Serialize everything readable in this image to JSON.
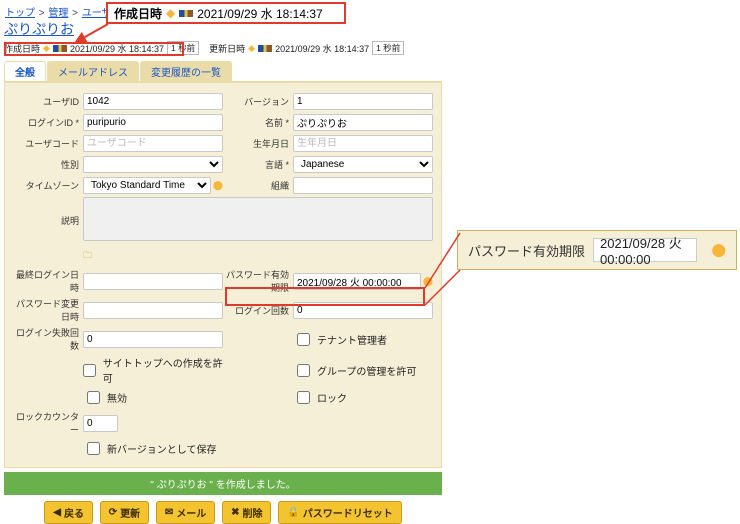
{
  "breadcrumb": {
    "top": "トップ",
    "mgmt": "管理",
    "user": "ユーザ"
  },
  "record_title": "ぷりぷりお",
  "timestamps": {
    "created_label": "作成日時",
    "created_value": "2021/09/29 水 18:14:37",
    "updated_label": "更新日時",
    "updated_value": "2021/09/29 水 18:14:37",
    "ago": "1 秒前"
  },
  "callout": {
    "label": "作成日時",
    "value": "2021/09/29 水 18:14:37"
  },
  "tabs": {
    "general": "全般",
    "mail": "メールアドレス",
    "history": "変更履歴の一覧"
  },
  "fields": {
    "user_id_l": "ユーザID",
    "user_id_v": "1042",
    "version_l": "バージョン",
    "version_v": "1",
    "login_l": "ログインID *",
    "login_v": "puripurio",
    "name_l": "名前 *",
    "name_v": "ぷりぷりお",
    "code_l": "ユーザコード",
    "code_ph": "ユーザコード",
    "birth_l": "生年月日",
    "birth_ph": "生年月日",
    "gender_l": "性別",
    "gender_v": "　",
    "lang_l": "言語 *",
    "lang_v": "Japanese",
    "tz_l": "タイムゾーン",
    "tz_v": "Tokyo Standard Time",
    "comp_l": "組織",
    "desc_l": "説明",
    "last_login_l": "最終ログイン日時",
    "pwexp_l": "パスワード有効期限",
    "pwexp_v": "2021/09/28 火 00:00:00",
    "pwchg_l": "パスワード変更日時",
    "logincnt_l": "ログイン回数",
    "logincnt_v": "0",
    "failcnt_l": "ログイン失敗回数",
    "failcnt_v": "0",
    "tenant_mgr": "テナント管理者",
    "allow_sitetop": "サイトトップへの作成を許可",
    "allow_group": "グループの管理を許可",
    "disabled": "無効",
    "locked": "ロック",
    "lockcnt_l": "ロックカウンター",
    "lockcnt_v": "0",
    "save_new_ver": "新バージョンとして保存"
  },
  "msg": "\" ぷりぷりお \" を作成しました。",
  "buttons": {
    "back": "戻る",
    "update": "更新",
    "mail": "メール",
    "delete": "削除",
    "pwreset": "パスワードリセット"
  },
  "magnify": {
    "label": "パスワード有効期限",
    "value": "2021/09/28 火 00:00:00"
  }
}
